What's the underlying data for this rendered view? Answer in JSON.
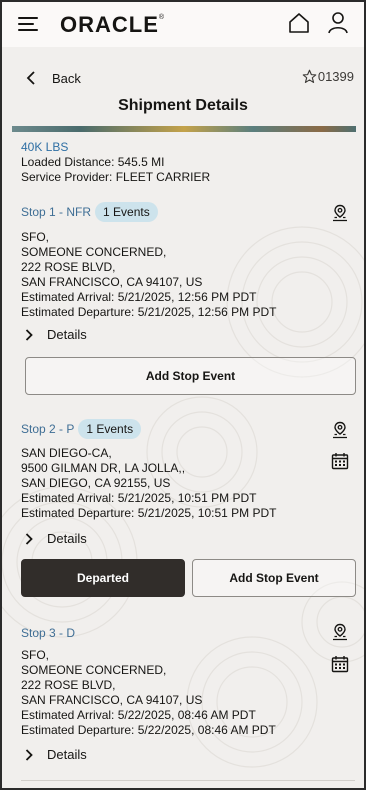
{
  "header": {
    "logo": "ORACLE",
    "logo_mark": "®"
  },
  "nav": {
    "back_label": "Back",
    "favorite_count": "01399"
  },
  "page": {
    "title": "Shipment Details"
  },
  "summary": {
    "weight": "40K LBS",
    "loaded_distance": "Loaded Distance: 545.5 MI",
    "service_provider": "Service Provider: FLEET CARRIER"
  },
  "stops": [
    {
      "label": "Stop 1 - NFR",
      "events": "1 Events",
      "lines": [
        "SFO,",
        "SOMEONE CONCERNED,",
        "222 ROSE BLVD,",
        "SAN FRANCISCO, CA 94107, US",
        "Estimated Arrival: 5/21/2025, 12:56 PM PDT",
        "Estimated Departure: 5/21/2025, 12:56 PM PDT"
      ],
      "details_label": "Details",
      "add_event_label": "Add Stop Event"
    },
    {
      "label": "Stop 2 - P",
      "events": "1 Events",
      "lines": [
        "SAN DIEGO-CA,",
        "9500 GILMAN DR, LA JOLLA,,",
        "SAN DIEGO, CA 92155, US",
        "Estimated Arrival: 5/21/2025, 10:51 PM PDT",
        "Estimated Departure: 5/21/2025, 10:51 PM PDT"
      ],
      "details_label": "Details",
      "departed_label": "Departed",
      "add_event_label": "Add Stop Event"
    },
    {
      "label": "Stop 3 - D",
      "lines": [
        "SFO,",
        "SOMEONE CONCERNED,",
        "222 ROSE BLVD,",
        "SAN FRANCISCO, CA 94107, US",
        "Estimated Arrival: 5/22/2025, 08:46 AM PDT",
        "Estimated Departure: 5/22/2025, 08:46 AM PDT"
      ],
      "details_label": "Details"
    }
  ],
  "icons": {
    "menu": "hamburger-menu-icon",
    "home": "home-icon",
    "profile": "user-profile-icon",
    "back": "chevron-left-icon",
    "favorite": "star-outline-icon",
    "location": "map-pin-icon",
    "calendar": "calendar-icon",
    "expand": "chevron-right-icon"
  },
  "colors": {
    "accent_link": "#2f6fa4",
    "badge_bg": "#cde3ec",
    "primary_button": "#312d2a",
    "background": "#f1efed"
  }
}
